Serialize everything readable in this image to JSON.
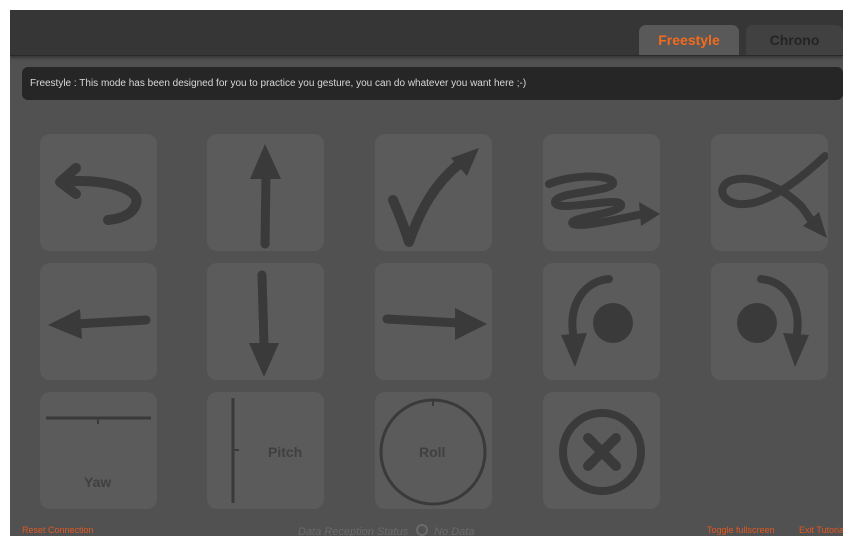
{
  "tabs": [
    {
      "label": "Freestyle",
      "active": true
    },
    {
      "label": "Chrono",
      "active": false
    }
  ],
  "description": "Freestyle : This mode has been designed for you to practice you gesture, you can do whatever you want here ;-)",
  "gestures": {
    "row1": [
      "undo-arrow-icon",
      "arrow-up-icon",
      "checkmark-icon",
      "scribble-arrow-icon",
      "loop-arrow-icon"
    ],
    "row2": [
      "arrow-left-icon",
      "arrow-down-icon",
      "arrow-right-icon",
      "rotate-counterclockwise-icon",
      "rotate-clockwise-icon"
    ],
    "row3": [
      "yaw-icon",
      "pitch-icon",
      "roll-icon",
      "cancel-icon"
    ]
  },
  "tile_labels": {
    "yaw": "Yaw",
    "pitch": "Pitch",
    "roll": "Roll"
  },
  "footer": {
    "reset_connection": "Reset Connection",
    "status_label": "Data Reception Status",
    "status_value": "No Data",
    "toggle_fullscreen": "Toggle fullscreen",
    "exit_tutorial": "Exit Tutorial"
  },
  "colors": {
    "accent": "#f26b1d",
    "background": "#515151",
    "tile": "#5b5b5b",
    "glyph": "#3a3a3a"
  }
}
